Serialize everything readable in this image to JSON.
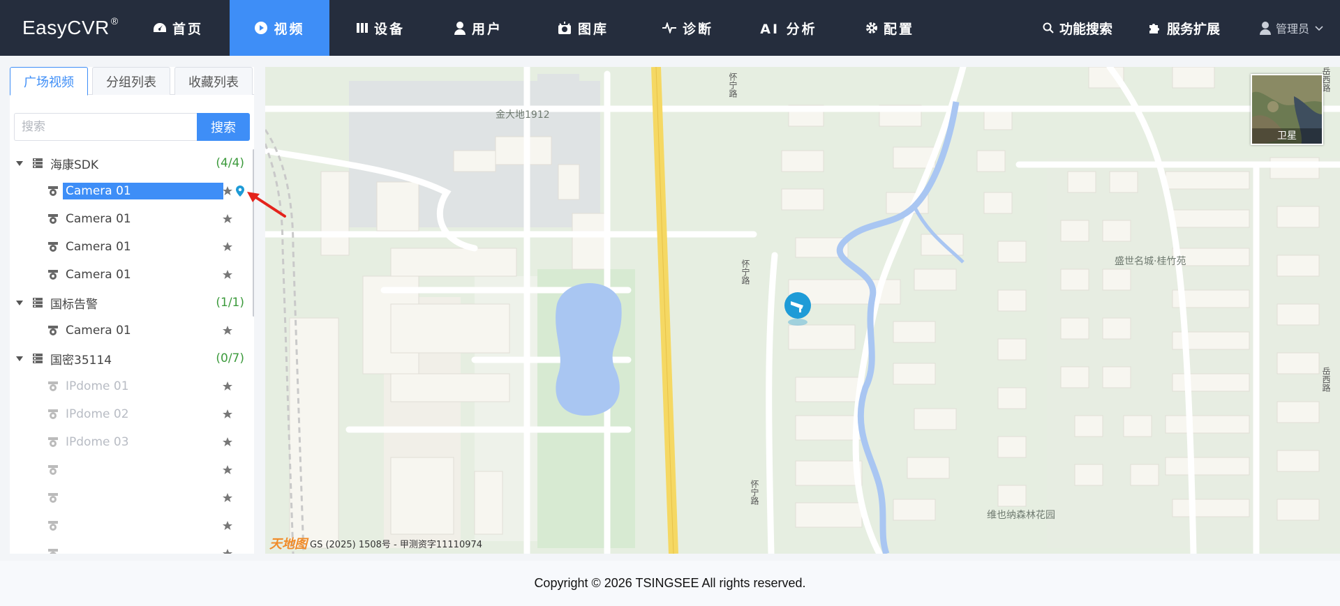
{
  "brand": {
    "name": "EasyCVR",
    "mark": "®"
  },
  "nav": [
    {
      "label": "首页",
      "icon": "dashboard-icon"
    },
    {
      "label": "视频",
      "icon": "play-circle-icon"
    },
    {
      "label": "设备",
      "icon": "device-icon"
    },
    {
      "label": "用户",
      "icon": "user-icon"
    },
    {
      "label": "图库",
      "icon": "camera-icon"
    },
    {
      "label": "诊断",
      "icon": "pulse-icon"
    },
    {
      "label": "AI 分析",
      "icon": ""
    },
    {
      "label": "配置",
      "icon": "gear-icon"
    }
  ],
  "right_nav": {
    "search": "功能搜索",
    "extend": "服务扩展",
    "user": "管理员"
  },
  "sidebar": {
    "tabs": [
      "广场视频",
      "分组列表",
      "收藏列表"
    ],
    "search_placeholder": "搜索",
    "search_button": "搜索",
    "groups": [
      {
        "name": "海康SDK",
        "count": "(4/4)"
      },
      {
        "name": "国标告警",
        "count": "(1/1)"
      },
      {
        "name": "国密35114",
        "count": "(0/7)"
      }
    ],
    "cameras": [
      {
        "label": "Camera 01"
      },
      {
        "label": "Camera 01"
      },
      {
        "label": "Camera 01"
      },
      {
        "label": "Camera 01"
      },
      {
        "label": "Camera 01"
      },
      {
        "label": "IPdome 01"
      },
      {
        "label": "IPdome 02"
      },
      {
        "label": "IPdome 03"
      }
    ]
  },
  "map": {
    "satellite_label": "卫星",
    "places": [
      "金大地1912",
      "盛世名城·桂竹苑",
      "维也纳森林花园"
    ],
    "roads": [
      "怀宁路",
      "怀宁路",
      "怀宁路",
      "岳西路",
      "岳西路"
    ],
    "attribution_logo": "天地图",
    "attribution_text": "GS (2025) 1508号 - 甲测资字11110974"
  },
  "footer": {
    "copyright": "Copyright © 2026 TSINGSEE All rights reserved."
  },
  "colors": {
    "accent": "#3e8ef7",
    "header_bg": "#252d3d",
    "count_green": "#3c9a3c"
  }
}
